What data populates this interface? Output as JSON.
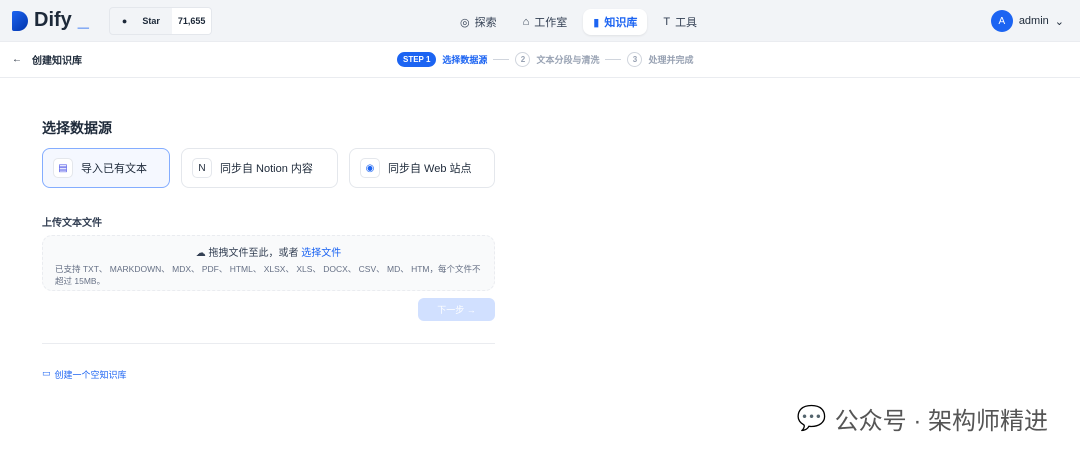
{
  "header": {
    "logo": "Dify",
    "github_star": "Star",
    "star_count": "71,655",
    "nav": [
      {
        "label": "探索"
      },
      {
        "label": "工作室"
      },
      {
        "label": "知识库"
      },
      {
        "label": "工具"
      }
    ],
    "user": {
      "initial": "A",
      "name": "admin"
    }
  },
  "subheader": {
    "title": "创建知识库",
    "steps": [
      {
        "badge": "STEP 1",
        "label": "选择数据源"
      },
      {
        "num": "2",
        "label": "文本分段与清洗"
      },
      {
        "num": "3",
        "label": "处理并完成"
      }
    ]
  },
  "main": {
    "title": "选择数据源",
    "sources": [
      {
        "label": "导入已有文本"
      },
      {
        "label": "同步自 Notion 内容"
      },
      {
        "label": "同步自 Web 站点"
      }
    ],
    "upload_label": "上传文本文件",
    "drop_text": "拖拽文件至此，或者",
    "drop_link": "选择文件",
    "supported": "已支持 TXT、 MARKDOWN、 MDX、 PDF、 HTML、 XLSX、 XLS、 DOCX、 CSV、 MD、 HTM，每个文件不超过 15MB。",
    "next": "下一步 →",
    "create_empty": "创建一个空知识库"
  },
  "watermark": "公众号 · 架构师精进"
}
